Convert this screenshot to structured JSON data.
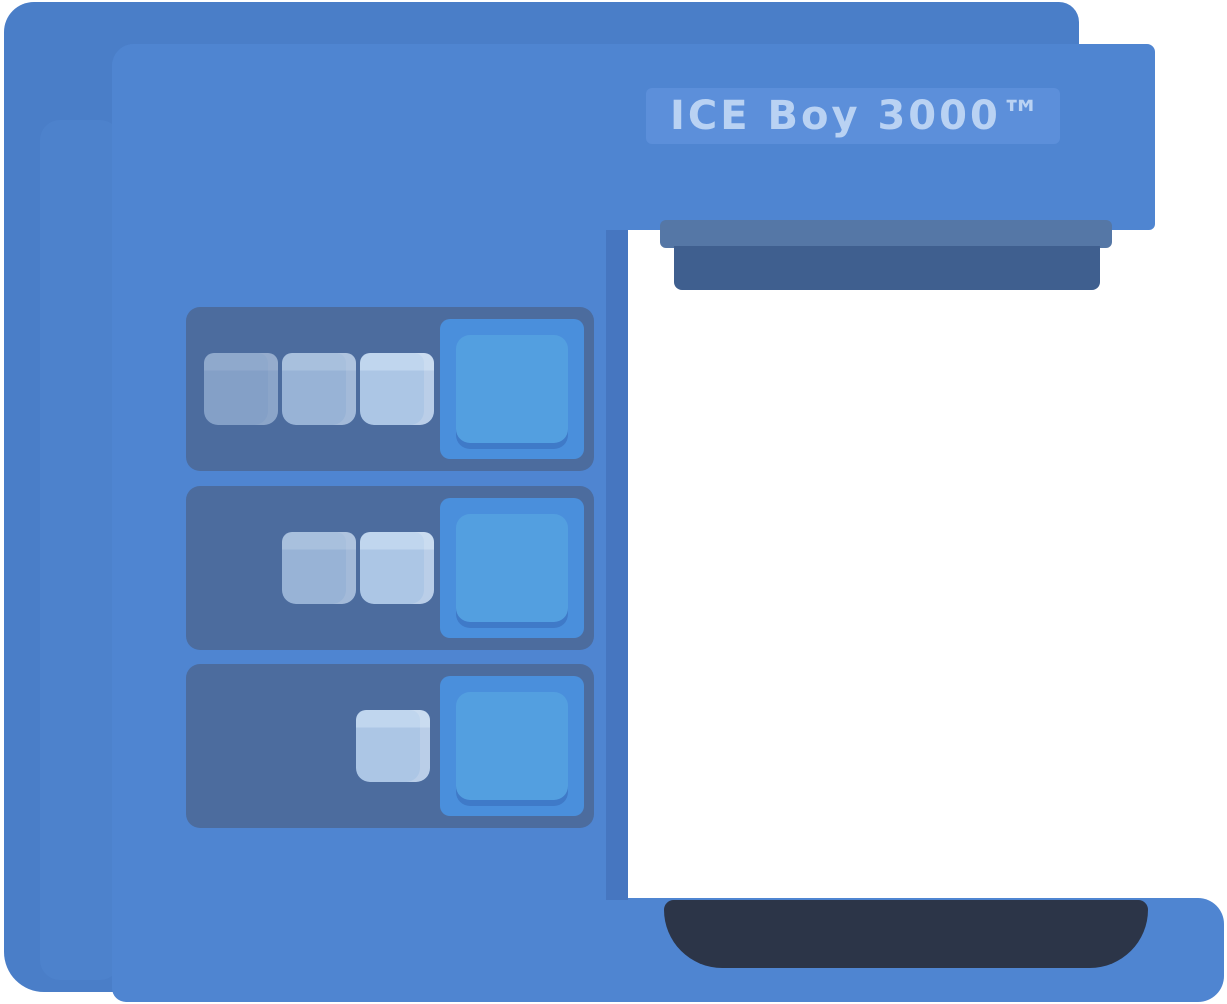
{
  "brand": {
    "name": "ICE Boy 3000™"
  },
  "icons": {
    "ice_cube": "ice-cube-icon"
  },
  "colors": {
    "body": "#4f85d1",
    "panel": "#4c6c9e",
    "button": "#539fe0",
    "drip_tray": "#2c3548",
    "brand_text": "#b9d2f3"
  },
  "panels": [
    {
      "cube_count": 3
    },
    {
      "cube_count": 2
    },
    {
      "cube_count": 1
    }
  ]
}
